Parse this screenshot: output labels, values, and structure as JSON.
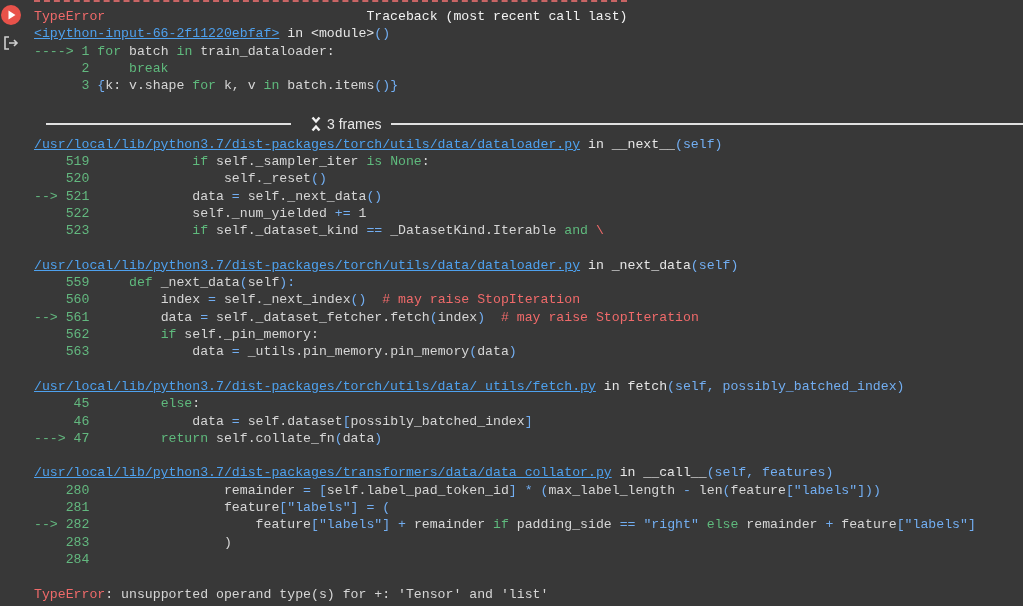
{
  "traceback": {
    "error_type": "TypeError",
    "title": "Traceback (most recent call last)",
    "source_link": "<ipython-input-66-2f11220ebfaf>",
    "context": [
      {
        "text": "in <module>"
      },
      {
        "kind": "punct",
        "text": "()"
      }
    ],
    "lines": [
      {
        "marker": "---->",
        "number": "1",
        "code": [
          {
            "kind": "keyword",
            "text": "for"
          },
          {
            "text": " batch "
          },
          {
            "kind": "keyword",
            "text": "in"
          },
          {
            "text": " train_dataloader:"
          }
        ]
      },
      {
        "number": "2",
        "code": [
          {
            "kind": "keyword",
            "text": "    break"
          }
        ]
      },
      {
        "number": "3",
        "code": [
          {
            "kind": "punct",
            "text": "{"
          },
          {
            "text": "k: v.shape "
          },
          {
            "kind": "keyword",
            "text": "for"
          },
          {
            "text": " k, v "
          },
          {
            "kind": "keyword",
            "text": "in"
          },
          {
            "text": " batch.items"
          },
          {
            "kind": "punct",
            "text": "()}"
          }
        ]
      }
    ]
  },
  "frames_toggle": {
    "label": "3 frames"
  },
  "frames": [
    {
      "file": "/usr/local/lib/python3.7/dist-packages/torch/utils/data/dataloader.py",
      "context": [
        {
          "text": "in __next__"
        },
        {
          "kind": "punct",
          "text": "(self)"
        }
      ],
      "lines": [
        {
          "number": "519",
          "code": [
            {
              "kind": "keyword",
              "text": "            if"
            },
            {
              "text": " self._sampler_iter "
            },
            {
              "kind": "keyword",
              "text": "is None"
            },
            {
              "text": ":"
            }
          ]
        },
        {
          "number": "520",
          "code": [
            {
              "text": "                self._reset"
            },
            {
              "kind": "punct",
              "text": "()"
            }
          ]
        },
        {
          "marker": "-->",
          "number": "521",
          "code": [
            {
              "text": "            data "
            },
            {
              "kind": "punct",
              "text": "="
            },
            {
              "text": " self._next_data"
            },
            {
              "kind": "punct",
              "text": "()"
            }
          ]
        },
        {
          "number": "522",
          "code": [
            {
              "text": "            self._num_yielded "
            },
            {
              "kind": "punct",
              "text": "+="
            },
            {
              "text": " 1"
            }
          ]
        },
        {
          "number": "523",
          "code": [
            {
              "kind": "keyword",
              "text": "            if"
            },
            {
              "text": " self._dataset_kind "
            },
            {
              "kind": "punct",
              "text": "=="
            },
            {
              "text": " _DatasetKind.Iterable "
            },
            {
              "kind": "keyword",
              "text": "and"
            },
            {
              "kind": "comment",
              "text": " \\"
            }
          ]
        }
      ]
    },
    {
      "file": "/usr/local/lib/python3.7/dist-packages/torch/utils/data/dataloader.py",
      "context": [
        {
          "text": "in _next_data"
        },
        {
          "kind": "punct",
          "text": "(self)"
        }
      ],
      "lines": [
        {
          "number": "559",
          "code": [
            {
              "kind": "keyword",
              "text": "    def"
            },
            {
              "text": " _next_data"
            },
            {
              "kind": "punct",
              "text": "("
            },
            {
              "text": "self"
            },
            {
              "kind": "punct",
              "text": "):"
            }
          ]
        },
        {
          "number": "560",
          "code": [
            {
              "text": "        index "
            },
            {
              "kind": "punct",
              "text": "="
            },
            {
              "text": " self._next_index"
            },
            {
              "kind": "punct",
              "text": "()"
            },
            {
              "kind": "comment",
              "text": "  # may raise StopIteration"
            }
          ]
        },
        {
          "marker": "-->",
          "number": "561",
          "code": [
            {
              "text": "        data "
            },
            {
              "kind": "punct",
              "text": "="
            },
            {
              "text": " self._dataset_fetcher.fetch"
            },
            {
              "kind": "punct",
              "text": "("
            },
            {
              "text": "index"
            },
            {
              "kind": "punct",
              "text": ")"
            },
            {
              "kind": "comment",
              "text": "  # may raise StopIteration"
            }
          ]
        },
        {
          "number": "562",
          "code": [
            {
              "kind": "keyword",
              "text": "        if"
            },
            {
              "text": " self._pin_memory:"
            }
          ]
        },
        {
          "number": "563",
          "code": [
            {
              "text": "            data "
            },
            {
              "kind": "punct",
              "text": "="
            },
            {
              "text": " _utils.pin_memory.pin_memory"
            },
            {
              "kind": "punct",
              "text": "("
            },
            {
              "text": "data"
            },
            {
              "kind": "punct",
              "text": ")"
            }
          ]
        }
      ]
    },
    {
      "file": "/usr/local/lib/python3.7/dist-packages/torch/utils/data/_utils/fetch.py",
      "context": [
        {
          "text": "in fetch"
        },
        {
          "kind": "punct",
          "text": "(self, possibly_batched_index)"
        }
      ],
      "lines": [
        {
          "number": "45",
          "code": [
            {
              "kind": "keyword",
              "text": "        else"
            },
            {
              "text": ":"
            }
          ]
        },
        {
          "number": "46",
          "code": [
            {
              "text": "            data "
            },
            {
              "kind": "punct",
              "text": "="
            },
            {
              "text": " self.dataset"
            },
            {
              "kind": "punct",
              "text": "["
            },
            {
              "text": "possibly_batched_index"
            },
            {
              "kind": "punct",
              "text": "]"
            }
          ]
        },
        {
          "marker": "--->",
          "number": "47",
          "code": [
            {
              "kind": "keyword",
              "text": "        return"
            },
            {
              "text": " self.collate_fn"
            },
            {
              "kind": "punct",
              "text": "("
            },
            {
              "text": "data"
            },
            {
              "kind": "punct",
              "text": ")"
            }
          ]
        }
      ]
    },
    {
      "file": "/usr/local/lib/python3.7/dist-packages/transformers/data/data_collator.py",
      "context": [
        {
          "text": "in __call__"
        },
        {
          "kind": "punct",
          "text": "(self, features)"
        }
      ],
      "lines": [
        {
          "number": "280",
          "code": [
            {
              "text": "                remainder "
            },
            {
              "kind": "punct",
              "text": "= ["
            },
            {
              "text": "self.label_pad_token_id"
            },
            {
              "kind": "punct",
              "text": "] * ("
            },
            {
              "text": "max_label_length "
            },
            {
              "kind": "punct",
              "text": "-"
            },
            {
              "text": " len"
            },
            {
              "kind": "punct",
              "text": "("
            },
            {
              "text": "feature"
            },
            {
              "kind": "punct",
              "text": "["
            },
            {
              "kind": "string",
              "text": "\"labels\""
            },
            {
              "kind": "punct",
              "text": "]))"
            }
          ]
        },
        {
          "number": "281",
          "code": [
            {
              "text": "                feature"
            },
            {
              "kind": "punct",
              "text": "["
            },
            {
              "kind": "string",
              "text": "\"labels\""
            },
            {
              "kind": "punct",
              "text": "] = ("
            }
          ]
        },
        {
          "marker": "-->",
          "number": "282",
          "code": [
            {
              "text": "                    feature"
            },
            {
              "kind": "punct",
              "text": "["
            },
            {
              "kind": "string",
              "text": "\"labels\""
            },
            {
              "kind": "punct",
              "text": "] +"
            },
            {
              "text": " remainder "
            },
            {
              "kind": "keyword",
              "text": "if"
            },
            {
              "text": " padding_side "
            },
            {
              "kind": "punct",
              "text": "=="
            },
            {
              "kind": "string",
              "text": " \"right\""
            },
            {
              "kind": "keyword",
              "text": " else"
            },
            {
              "text": " remainder "
            },
            {
              "kind": "punct",
              "text": "+"
            },
            {
              "text": " feature"
            },
            {
              "kind": "punct",
              "text": "["
            },
            {
              "kind": "string",
              "text": "\"labels\""
            },
            {
              "kind": "punct",
              "text": "]"
            }
          ]
        },
        {
          "number": "283",
          "code": [
            {
              "text": "                )"
            }
          ]
        },
        {
          "number": "284"
        }
      ]
    }
  ],
  "error": {
    "type": "TypeError",
    "message": ": unsupported operand type(s) for +: 'Tensor' and 'list'"
  }
}
